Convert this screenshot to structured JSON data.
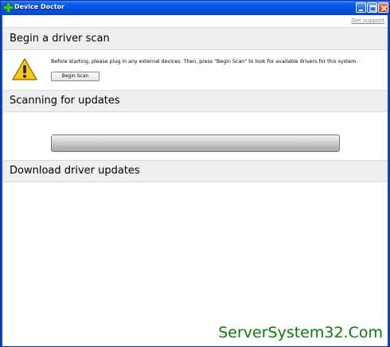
{
  "window": {
    "title": "Device Doctor"
  },
  "links": {
    "support": "Get support"
  },
  "sections": {
    "scan": {
      "heading": "Begin a driver scan",
      "message": "Before starting, please plug in any external devices. Then, press \"Begin Scan\" to look for available drivers for this system.",
      "button_label": "Begin Scan"
    },
    "updates": {
      "heading": "Scanning for updates",
      "progress": 1.0
    },
    "download": {
      "heading": "Download driver updates"
    }
  },
  "watermark": "ServerSystem32.Com",
  "colors": {
    "titlebar": "#0550e0",
    "section_bg": "#efefef",
    "watermark": "#0a7a0a",
    "warning": "#f0c020"
  }
}
